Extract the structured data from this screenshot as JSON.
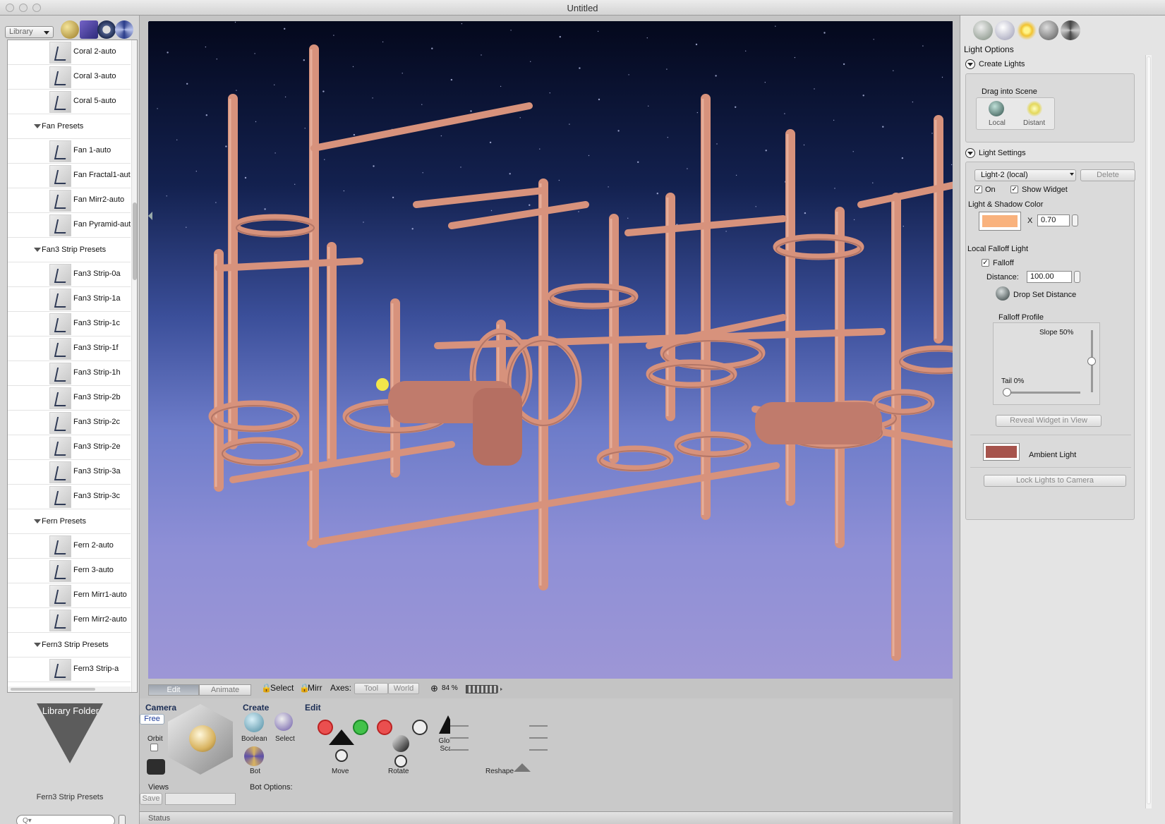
{
  "window": {
    "title": "Untitled"
  },
  "library": {
    "selector": "Library",
    "items": [
      {
        "type": "item",
        "label": "Coral 2-auto"
      },
      {
        "type": "item",
        "label": "Coral 3-auto"
      },
      {
        "type": "item",
        "label": "Coral 5-auto"
      },
      {
        "type": "group",
        "label": "Fan Presets"
      },
      {
        "type": "item",
        "label": "Fan 1-auto"
      },
      {
        "type": "item",
        "label": "Fan Fractal1-aut"
      },
      {
        "type": "item",
        "label": "Fan Mirr2-auto"
      },
      {
        "type": "item",
        "label": "Fan Pyramid-aut"
      },
      {
        "type": "group",
        "label": "Fan3 Strip Presets"
      },
      {
        "type": "item",
        "label": "Fan3 Strip-0a"
      },
      {
        "type": "item",
        "label": "Fan3 Strip-1a"
      },
      {
        "type": "item",
        "label": "Fan3 Strip-1c"
      },
      {
        "type": "item",
        "label": "Fan3 Strip-1f"
      },
      {
        "type": "item",
        "label": "Fan3 Strip-1h"
      },
      {
        "type": "item",
        "label": "Fan3 Strip-2b"
      },
      {
        "type": "item",
        "label": "Fan3 Strip-2c"
      },
      {
        "type": "item",
        "label": "Fan3 Strip-2e"
      },
      {
        "type": "item",
        "label": "Fan3 Strip-3a"
      },
      {
        "type": "item",
        "label": "Fan3 Strip-3c"
      },
      {
        "type": "group",
        "label": "Fern Presets"
      },
      {
        "type": "item",
        "label": "Fern 2-auto"
      },
      {
        "type": "item",
        "label": "Fern 3-auto"
      },
      {
        "type": "item",
        "label": "Fern Mirr1-auto"
      },
      {
        "type": "item",
        "label": "Fern Mirr2-auto"
      },
      {
        "type": "group",
        "label": "Fern3 Strip Presets"
      },
      {
        "type": "item",
        "label": "Fern3 Strip-a"
      }
    ],
    "folder_label": "Library Folder",
    "folder_path": "Fern3 Strip Presets",
    "search_placeholder": "Q▾"
  },
  "viewport_toolbar": {
    "tab_edit": "Edit",
    "tab_animate": "Animate",
    "select": "Select",
    "mirr": "Mirr",
    "axes": "Axes:",
    "tool": "Tool",
    "world": "World",
    "zoom": "84 %"
  },
  "tools": {
    "camera": {
      "heading": "Camera",
      "mode": "Free",
      "orbit": "Orbit",
      "views": "Views",
      "save": "Save"
    },
    "create": {
      "heading": "Create",
      "boolean": "Boolean",
      "select": "Select",
      "bot": "Bot"
    },
    "edit": {
      "heading": "Edit",
      "move": "Move",
      "rotate": "Rotate",
      "global_scale": "Global Scale",
      "reshape": "Reshape"
    },
    "bot_options": "Bot Options:"
  },
  "status": "Status",
  "light_options": {
    "title": "Light Options",
    "create_lights": {
      "heading": "Create Lights",
      "drag_hint": "Drag into Scene",
      "local": "Local",
      "distant": "Distant"
    },
    "light_settings": {
      "heading": "Light Settings",
      "selected_light": "Light-2 (local)",
      "delete": "Delete",
      "on_label": "On",
      "on": true,
      "show_widget_label": "Show Widget",
      "show_widget": true,
      "color_label": "Light & Shadow Color",
      "color": "#f9b27d",
      "multiplier_x": "X",
      "multiplier": "0.70",
      "falloff_section": "Local Falloff Light",
      "falloff_label": "Falloff",
      "falloff": true,
      "distance_label": "Distance:",
      "distance": "100.00",
      "drop_set_distance": "Drop Set Distance",
      "profile_label": "Falloff Profile",
      "slope": "Slope 50%",
      "slope_value": 0.5,
      "tail": "Tail 0%",
      "tail_value": 0,
      "reveal": "Reveal Widget in View",
      "ambient_label": "Ambient Light",
      "ambient_color": "#a6534c",
      "lock": "Lock Lights to Camera"
    }
  }
}
